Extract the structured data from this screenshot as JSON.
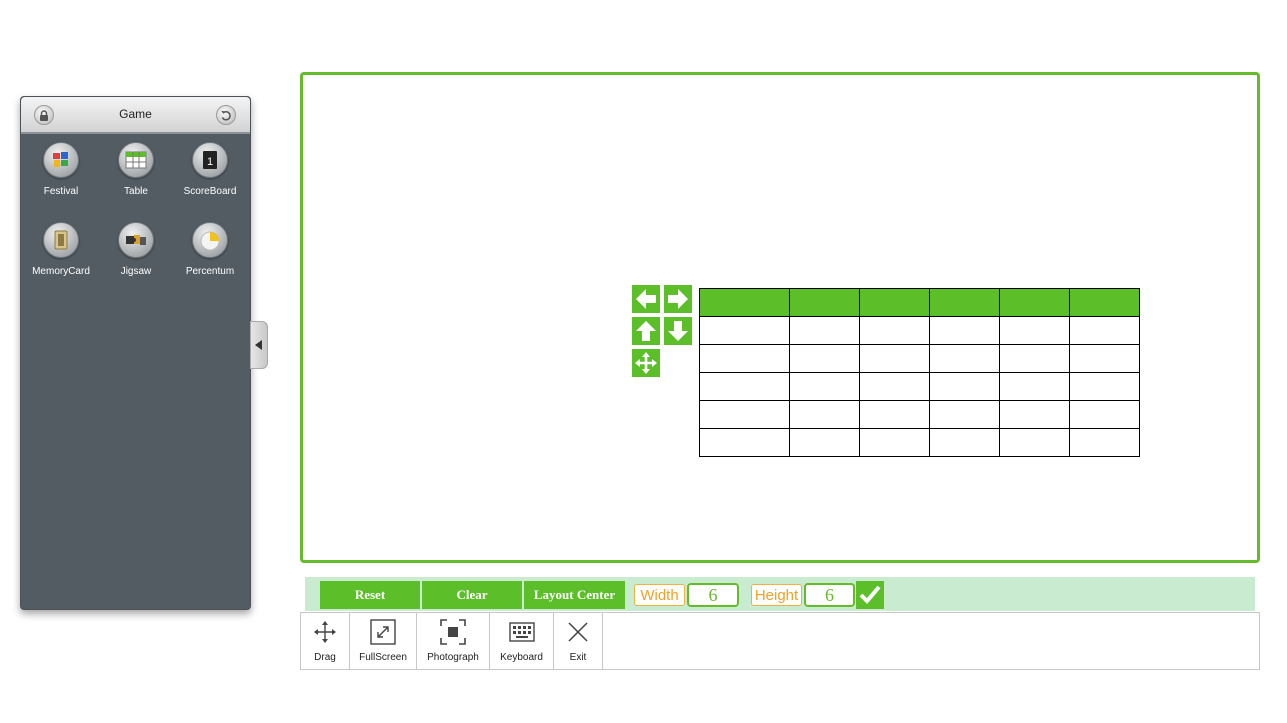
{
  "panel": {
    "title": "Game",
    "tools": [
      {
        "label": "Festival",
        "icon": "festival-icon"
      },
      {
        "label": "Table",
        "icon": "table-icon"
      },
      {
        "label": "ScoreBoard",
        "icon": "scoreboard-icon"
      },
      {
        "label": "MemoryCard",
        "icon": "memorycard-icon"
      },
      {
        "label": "Jigsaw",
        "icon": "jigsaw-icon"
      },
      {
        "label": "Percentum",
        "icon": "percentum-icon"
      }
    ]
  },
  "canvas": {
    "table": {
      "columns": 6,
      "rows": 6,
      "header_color": "#5cbf2a"
    }
  },
  "controls": {
    "reset": "Reset",
    "clear": "Clear",
    "layout_center": "Layout Center",
    "width_label": "Width",
    "width_value": "6",
    "height_label": "Height",
    "height_value": "6"
  },
  "toolbar": {
    "items": [
      {
        "label": "Drag",
        "icon": "move-icon"
      },
      {
        "label": "FullScreen",
        "icon": "fullscreen-icon"
      },
      {
        "label": "Photograph",
        "icon": "photograph-icon"
      },
      {
        "label": "Keyboard",
        "icon": "keyboard-icon"
      },
      {
        "label": "Exit",
        "icon": "close-icon"
      }
    ]
  },
  "colors": {
    "accent": "#5cbf2a",
    "panel_bg": "#535c63",
    "label_orange": "#f3a024",
    "control_bar_bg": "#c9ebcf"
  }
}
